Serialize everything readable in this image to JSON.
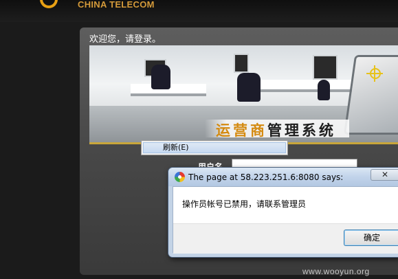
{
  "brand": {
    "name": "CHINA TELECOM",
    "logo_icon": "china-telecom-logo-icon",
    "accent": "#d49a3a"
  },
  "login_page": {
    "welcome": "欢迎您，请登录。",
    "banner": {
      "title_accent": "运营商",
      "title_rest": "管理系统"
    },
    "username_label": "用户名"
  },
  "context_menu": {
    "items": [
      {
        "label": "刷新(E)"
      }
    ]
  },
  "alert": {
    "title": "The page at 58.223.251.6:8080 says:",
    "close_symbol": "✕",
    "message": "操作员帐号已禁用，请联系管理员",
    "ok_label": "确定"
  },
  "watermark": "www.wooyun.org"
}
